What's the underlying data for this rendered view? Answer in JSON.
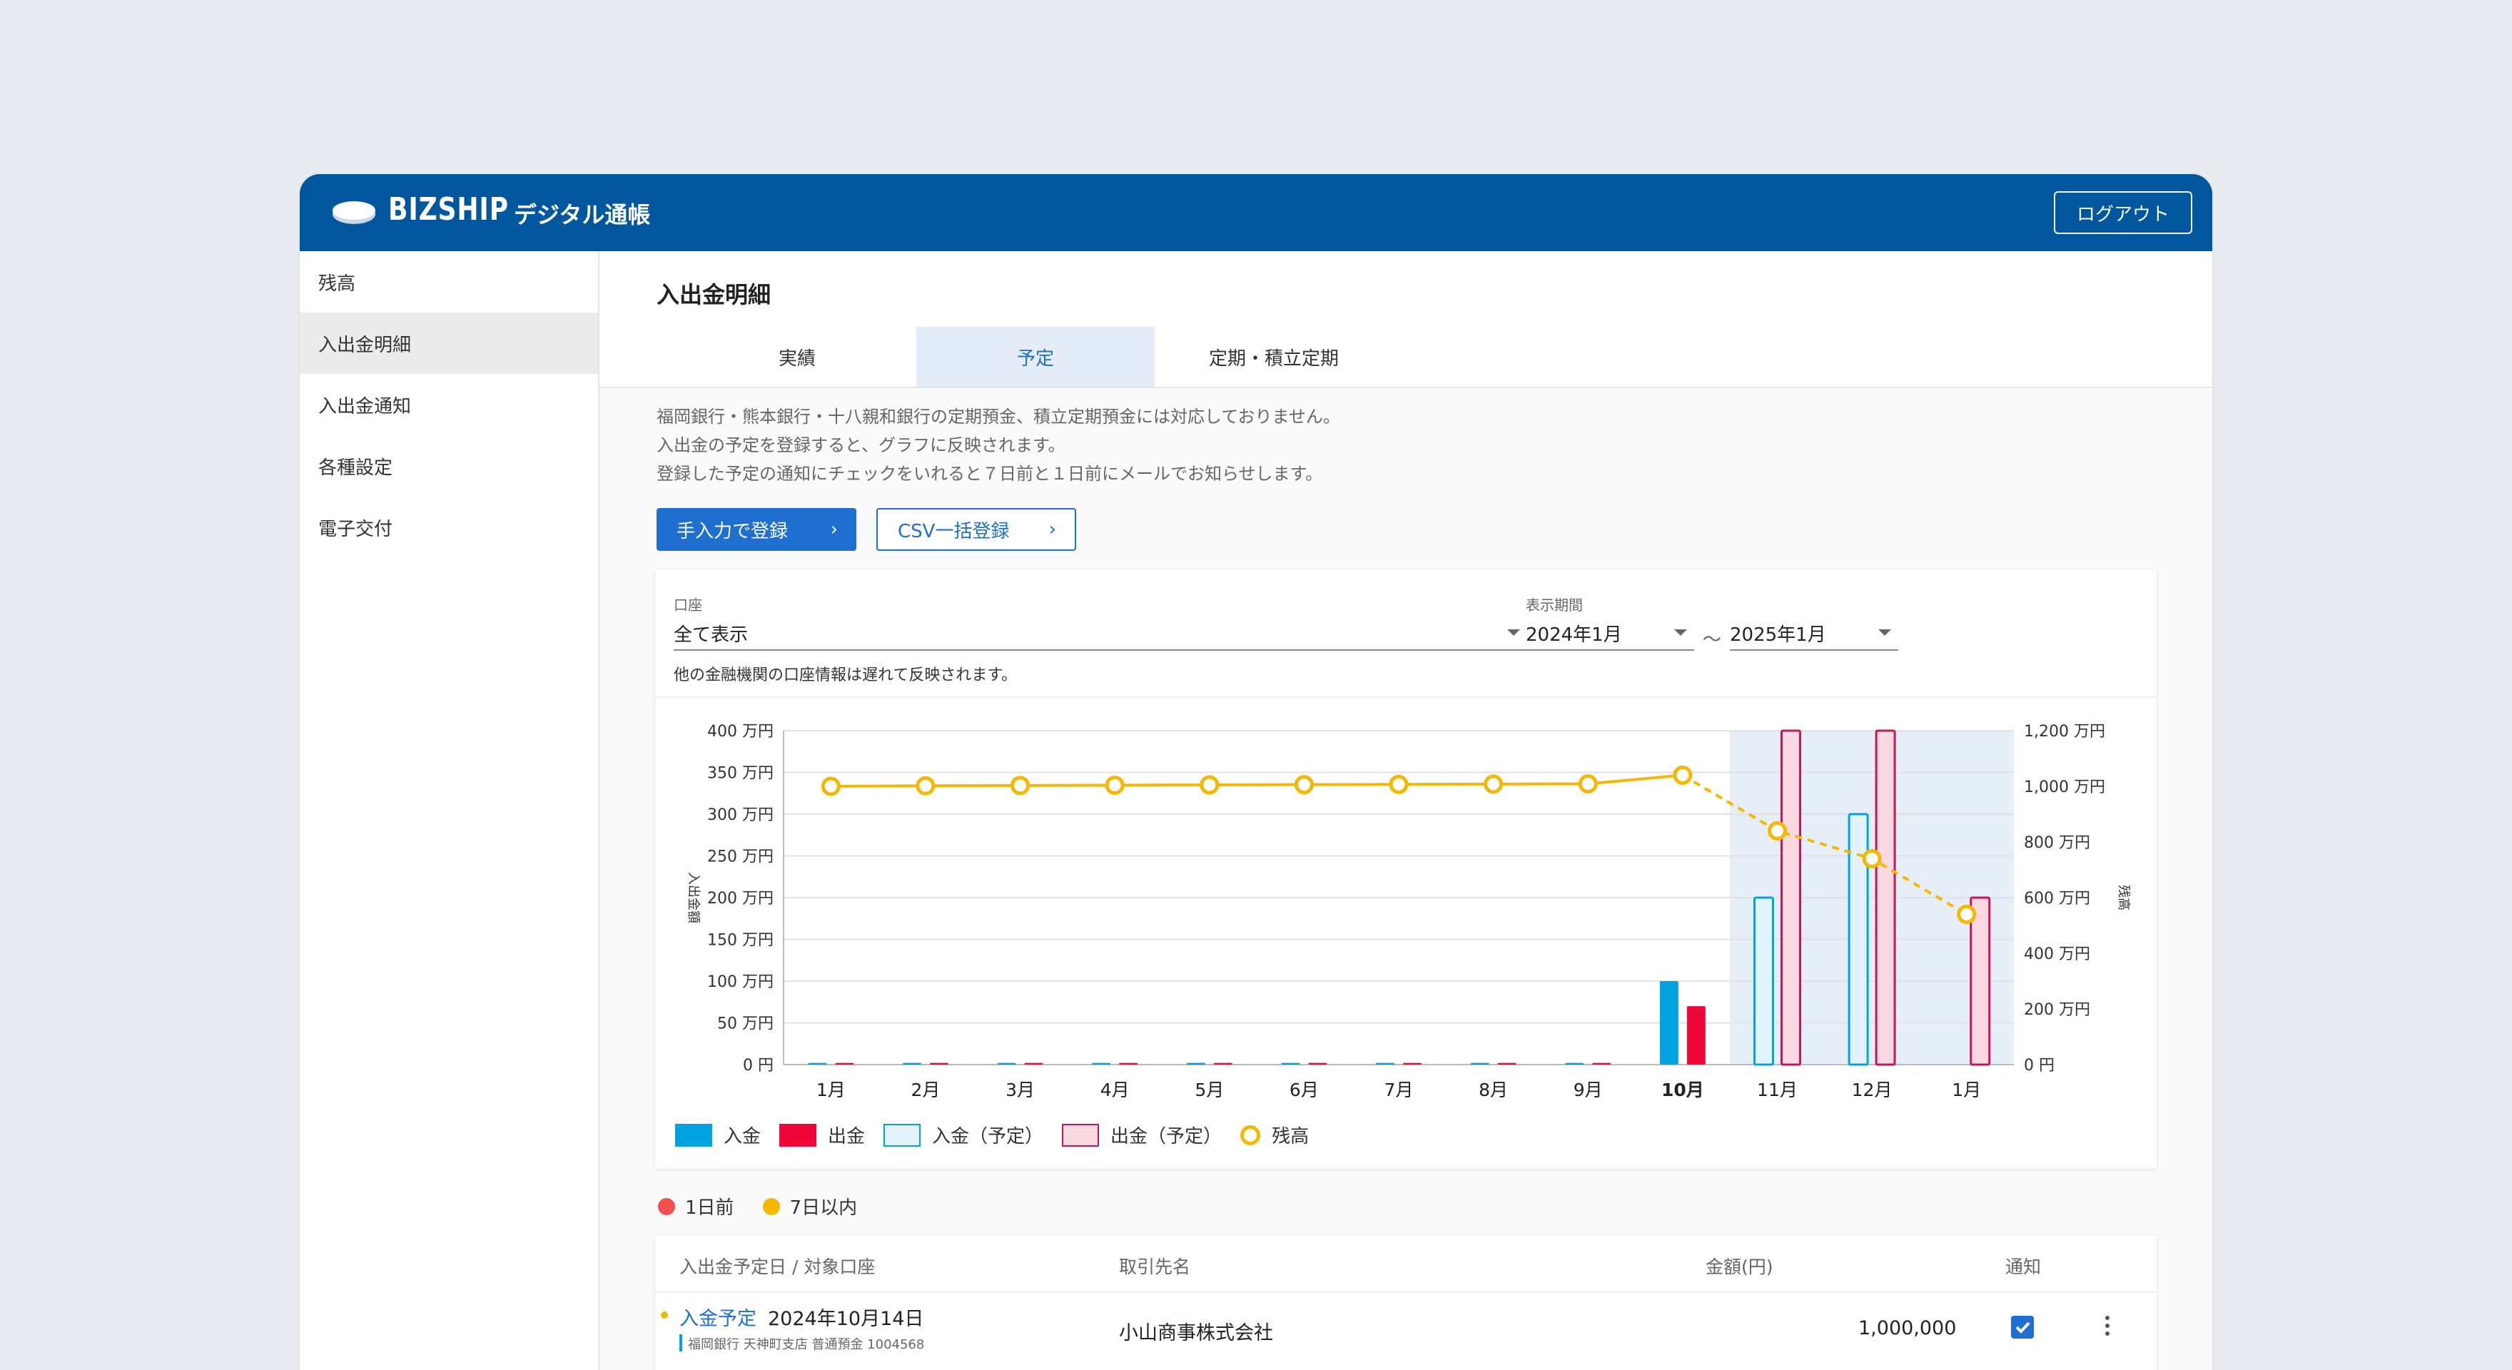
{
  "header": {
    "brand": "BIZSHIP",
    "app_title": "デジタル通帳",
    "logout": "ログアウト"
  },
  "sidebar": {
    "items": [
      {
        "label": "残高"
      },
      {
        "label": "入出金明細"
      },
      {
        "label": "入出金通知"
      },
      {
        "label": "各種設定"
      },
      {
        "label": "電子交付"
      }
    ]
  },
  "main": {
    "title": "入出金明細",
    "tabs": [
      {
        "label": "実績"
      },
      {
        "label": "予定"
      },
      {
        "label": "定期・積立定期"
      }
    ],
    "notes": [
      "福岡銀行・熊本銀行・十八親和銀行の定期預金、積立定期預金には対応しておりません。",
      "入出金の予定を登録すると、グラフに反映されます。",
      "登録した予定の通知にチェックをいれると７日前と１日前にメールでお知らせします。"
    ],
    "buttons": {
      "manual": "手入力で登録",
      "csv": "CSV一括登録"
    }
  },
  "filters": {
    "account_label": "口座",
    "account_value": "全て表示",
    "period_label": "表示期間",
    "period_from": "2024年1月",
    "tilde": "〜",
    "period_to": "2025年1月",
    "hint": "他の金融機関の口座情報は遅れて反映されます。"
  },
  "colors": {
    "deposit": "#00a3e0",
    "withdrawal": "#f0073a",
    "deposit_plan": "#e3f3fb",
    "withdrawal_plan": "#fbd9e1",
    "balance": "#f5b800",
    "forecast_band": "#e6eef8",
    "header": "#00579d",
    "primary": "#1f6fd1"
  },
  "chart_data": {
    "type": "bar",
    "categories": [
      "1月",
      "2月",
      "3月",
      "4月",
      "5月",
      "6月",
      "7月",
      "8月",
      "9月",
      "10月",
      "11月",
      "12月",
      "1月"
    ],
    "highlight_category": "10月",
    "forecast_start_index": 10,
    "series": [
      {
        "name": "入金",
        "values": [
          2,
          2,
          2,
          2,
          2,
          2,
          2,
          2,
          2,
          100,
          null,
          null,
          null
        ]
      },
      {
        "name": "出金",
        "values": [
          2,
          2,
          2,
          2,
          2,
          2,
          2,
          2,
          2,
          70,
          null,
          null,
          null
        ]
      },
      {
        "name": "入金（予定）",
        "values": [
          null,
          null,
          null,
          null,
          null,
          null,
          null,
          null,
          null,
          null,
          200,
          300,
          null
        ]
      },
      {
        "name": "出金（予定）",
        "values": [
          null,
          null,
          null,
          null,
          null,
          null,
          null,
          null,
          null,
          null,
          400,
          400,
          200
        ]
      },
      {
        "name": "残高",
        "axis": "right",
        "values": [
          1000,
          1002,
          1003,
          1004,
          1005,
          1006,
          1007,
          1008,
          1009,
          1040,
          840,
          740,
          540
        ]
      }
    ],
    "ylabel": "入出金額",
    "y2label": "残高",
    "ylim": [
      0,
      400
    ],
    "y2lim": [
      0,
      1200
    ],
    "yticks": [
      "0 円",
      "50 万円",
      "100 万円",
      "150 万円",
      "200 万円",
      "250 万円",
      "300 万円",
      "350 万円",
      "400 万円"
    ],
    "y2ticks": [
      "0 円",
      "200 万円",
      "400 万円",
      "600 万円",
      "800 万円",
      "1,000 万円",
      "1,200 万円"
    ],
    "grid": true,
    "legend": "bottom-left"
  },
  "status_legend": [
    {
      "label": "1日前",
      "color": "#f0514f"
    },
    {
      "label": "7日以内",
      "color": "#f5b800"
    }
  ],
  "table": {
    "headers": [
      "入出金予定日 / 対象口座",
      "取引先名",
      "金額(円)",
      "通知"
    ],
    "rows": [
      {
        "type": "入金予定",
        "date": "2024年10月14日",
        "account": "福岡銀行 天神町支店 普通預金 1004568",
        "partner": "小山商事株式会社",
        "amount": "1,000,000",
        "notify": true
      }
    ]
  }
}
